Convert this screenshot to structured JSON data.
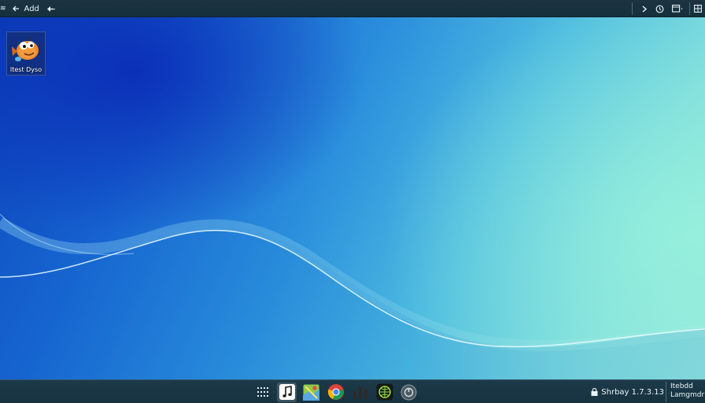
{
  "topbar": {
    "left_items": [
      {
        "label": "≋",
        "icon": "menu-icon"
      },
      {
        "label": "Add",
        "icon": "arrow-left-icon"
      },
      {
        "label": "",
        "icon": "back-arrow-icon"
      }
    ],
    "right_icons": [
      "chevron-right-icon",
      "clock-icon",
      "window-icon",
      "panel-icon"
    ]
  },
  "desktop": {
    "icons": [
      {
        "label": "Itest Dyso",
        "icon": "cartoon-fish-icon"
      }
    ]
  },
  "taskbar": {
    "apps": [
      {
        "name": "app-grid",
        "icon": "app-grid-icon",
        "active": false
      },
      {
        "name": "music",
        "icon": "music-note-icon",
        "active": true
      },
      {
        "name": "maps",
        "icon": "map-icon",
        "active": false
      },
      {
        "name": "chrome",
        "icon": "chrome-icon",
        "active": false
      },
      {
        "name": "audio",
        "icon": "audio-bars-icon",
        "active": false
      },
      {
        "name": "network",
        "icon": "network-globe-icon",
        "active": false
      },
      {
        "name": "settings",
        "icon": "power-icon",
        "active": false
      }
    ],
    "tray_text": "Shrbay 1.7.3.13",
    "clock_lines": [
      "Itebdd",
      "Lamgmdr"
    ]
  },
  "colors": {
    "topbar_bg": "#1c3342",
    "taskbar_bg": "#1d3a4a",
    "wallpaper_dark": "#0b3fb8",
    "wallpaper_light": "#9eeadb"
  }
}
